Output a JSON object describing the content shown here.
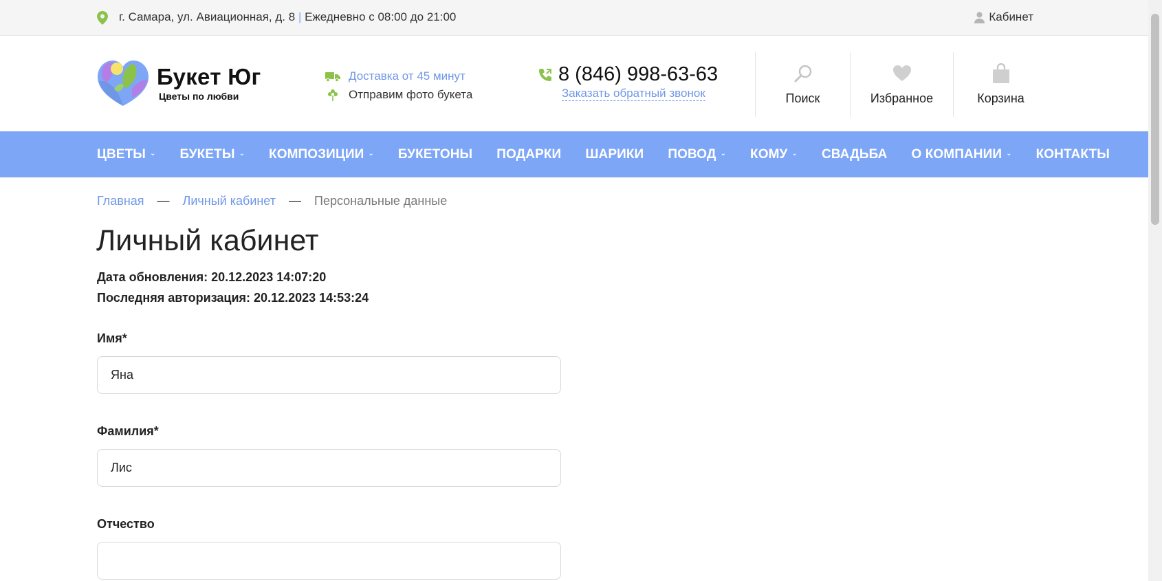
{
  "topbar": {
    "address": "г. Самара, ул. Авиационная, д. 8",
    "separator": "|",
    "hours": "Ежедневно с 08:00 до 21:00",
    "cabinet_label": "Кабинет",
    "pin_icon": "location-pin-icon",
    "pin_color": "#8bc34a"
  },
  "logo": {
    "title": "Букет Юг",
    "subtitle": "Цветы по любви"
  },
  "features": {
    "delivery": "Доставка от 45 минут",
    "photo": "Отправим фото букета"
  },
  "contact": {
    "phone": "8 (846) 998-63-63",
    "callback": "Заказать обратный звонок"
  },
  "header_buttons": {
    "search": "Поиск",
    "favorites": "Избранное",
    "cart": "Корзина"
  },
  "nav": {
    "items": [
      {
        "label": "Цветы",
        "dropdown": true
      },
      {
        "label": "Букеты",
        "dropdown": true
      },
      {
        "label": "Композиции",
        "dropdown": true
      },
      {
        "label": "Букетоны",
        "dropdown": false
      },
      {
        "label": "Подарки",
        "dropdown": false
      },
      {
        "label": "Шарики",
        "dropdown": false
      },
      {
        "label": "Повод",
        "dropdown": true
      },
      {
        "label": "Кому",
        "dropdown": true
      },
      {
        "label": "Свадьба",
        "dropdown": false
      },
      {
        "label": "О компании",
        "dropdown": true
      },
      {
        "label": "Контакты",
        "dropdown": false
      }
    ],
    "chevron": "⌄",
    "color": "#7ea6f6"
  },
  "breadcrumb": {
    "home": "Главная",
    "cabinet": "Личный кабинет",
    "current": "Персональные данные",
    "separator": "—"
  },
  "page": {
    "title": "Личный кабинет",
    "updated": "Дата обновления: 20.12.2023 14:07:20",
    "last_auth": "Последняя авторизация: 20.12.2023 14:53:24"
  },
  "form": {
    "first_name_label": "Имя*",
    "first_name_value": "Яна",
    "last_name_label": "Фамилия*",
    "last_name_value": "Лис",
    "middle_name_label": "Отчество",
    "middle_name_value": ""
  },
  "colors": {
    "accent_blue": "#7ea6f6",
    "link_blue": "#6f97e6",
    "accent_green": "#8bc34a"
  }
}
